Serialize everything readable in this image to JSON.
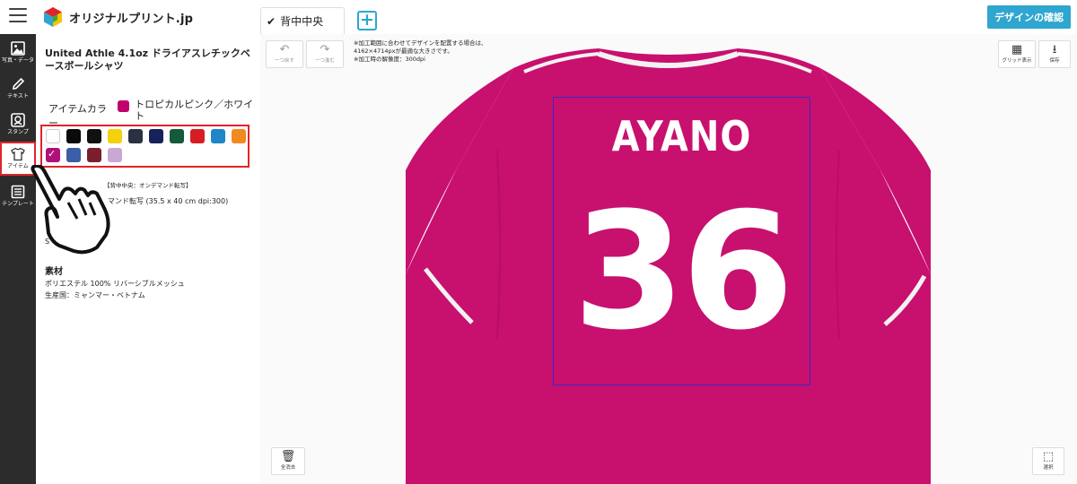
{
  "header": {
    "logo_text": "オリジナルプリント.jp",
    "confirm_button": "デザインの確認"
  },
  "tabs": [
    {
      "label": "背中中央",
      "active": true
    }
  ],
  "rail": {
    "items": [
      {
        "label": "写真・データ",
        "icon": "image-icon"
      },
      {
        "label": "テキスト",
        "icon": "pencil-icon"
      },
      {
        "label": "スタンプ",
        "icon": "stamp-icon"
      },
      {
        "label": "アイテム",
        "icon": "tshirt-icon",
        "active": true
      },
      {
        "label": "テンプレート",
        "icon": "template-icon"
      }
    ]
  },
  "panel": {
    "product_title": "United Athle 4.1oz ドライアスレチックベースボールシャツ",
    "item_color_label": "アイテムカラー",
    "selected_color_name": "トロピカルピンク／ホワイト",
    "selected_color": "#c2006b",
    "swatches": [
      "#ffffff",
      "#0a0a0a",
      "#111111",
      "#f3d10e",
      "#2b3142",
      "#15235a",
      "#155a3a",
      "#d71d24",
      "#1f86c7",
      "#f28a1e",
      "#b0107a",
      "#3a5fa8",
      "#7a1f2e",
      "#c9a8d6"
    ],
    "print_info_1": "【背中中央：オンデマンド転写】",
    "print_info_2": "マンド転写 (35.5 x 40 cm dpi:300)",
    "size": "S",
    "material_heading": "素材",
    "material_1": "ポリエステル 100% リバーシブルメッシュ",
    "material_2": "生産国：ミャンマー・ベトナム"
  },
  "canvas": {
    "undo_label": "一つ戻す",
    "redo_label": "一つ進む",
    "note_lines": [
      "※加工範囲に合わせてデザインを配置する場合は、",
      "4162×4714pxが最適な大きさです。",
      "※加工時の解像度：300dpi"
    ],
    "grid_label": "グリッド表示",
    "save_label": "保存",
    "clear_label": "全消去",
    "select_label": "選択",
    "design_name": "AYANO",
    "design_number": "36",
    "shirt_color": "#c8106e"
  }
}
